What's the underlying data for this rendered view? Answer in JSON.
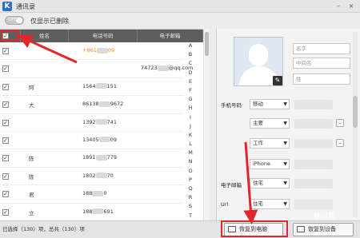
{
  "window": {
    "logo": "K",
    "title": "通讯录",
    "minimize": "–",
    "close": "×"
  },
  "toolbar": {
    "toggle_label": "OFF",
    "filter_label": "仅显示已删除"
  },
  "list": {
    "columns": [
      "姓名",
      "电话号码",
      "电子邮箱"
    ],
    "rows": [
      {
        "checked": true,
        "name": "",
        "phone": "+861",
        "phone_tail": "09",
        "email": ""
      },
      {
        "checked": true,
        "name": "",
        "phone": "",
        "phone_tail": "",
        "email": "74723",
        "email_tail": "@qq.com"
      },
      {
        "checked": true,
        "name": "阿",
        "phone": "1564",
        "phone_tail": "151",
        "email": ""
      },
      {
        "checked": true,
        "name": "大",
        "phone": "86138",
        "phone_tail": "9672",
        "email": ""
      },
      {
        "checked": true,
        "name": "",
        "phone": "1392",
        "phone_tail": "741",
        "email": ""
      },
      {
        "checked": true,
        "name": "",
        "phone": "13405",
        "phone_tail": "09",
        "email": ""
      },
      {
        "checked": true,
        "name": "陈",
        "phone": "1891",
        "phone_tail": "779",
        "email": ""
      },
      {
        "checked": true,
        "name": "陈",
        "phone": "1802",
        "phone_tail": "70",
        "email": ""
      },
      {
        "checked": true,
        "name": "君",
        "phone": "188",
        "phone_tail": "0",
        "email": ""
      },
      {
        "checked": true,
        "name": "立",
        "phone": "188",
        "phone_tail": "691",
        "email": ""
      }
    ],
    "alphabet": [
      "A",
      "B",
      "C",
      "D",
      "E",
      "F",
      "G",
      "H",
      "I",
      "J",
      "K",
      "L",
      "M",
      "N",
      "O",
      "P",
      "Q",
      "R",
      "S",
      "T"
    ]
  },
  "status": {
    "text": "已选择（130）项，总共（130）项"
  },
  "detail": {
    "first_name_placeholder": "名字",
    "middle_name_placeholder": "中间名",
    "last_name_placeholder": "姓",
    "phone_label": "手机号码",
    "phone_types": [
      "移动",
      "主要",
      "工作",
      "iPhone"
    ],
    "email_label": "电子邮箱",
    "email_type": "住宅",
    "address_type": "住宅",
    "url_label": "Url",
    "url_type": "住宅"
  },
  "actions": {
    "restore_pc": "恢复到电脑",
    "restore_device": "恢复到设备"
  },
  "watermark": "Bai百"
}
